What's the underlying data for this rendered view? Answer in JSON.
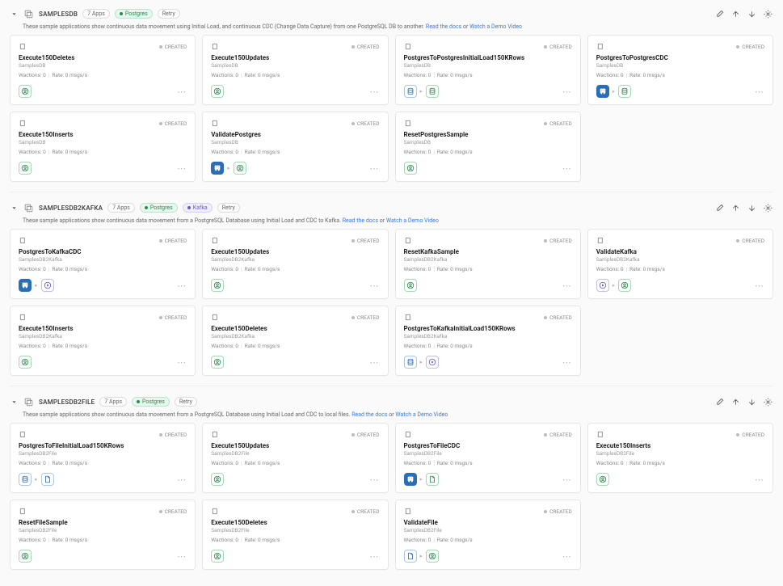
{
  "groups": [
    {
      "name": "SAMPLESDB",
      "count": "7 Apps",
      "tags": [
        {
          "kind": "post",
          "label": "Postgres"
        },
        {
          "kind": "retry",
          "label": "Retry"
        }
      ],
      "desc_plain": "These sample applications show continuous data movement using Initial Load, and continuous CDC (Change Data Capture) from one PostgreSQL DB to another. ",
      "link1": "Read the docs",
      "link_sep": " or ",
      "link2": "Watch a Demo Video",
      "cards": [
        {
          "title": "Execute150Deletes",
          "sub": "SamplesDB",
          "wact": "Wactions: 0",
          "rate": "Rate: 0 msgs/s",
          "status": "CREATED",
          "icons": [
            {
              "c": "green",
              "g": "circuser"
            }
          ]
        },
        {
          "title": "Execute150Updates",
          "sub": "SamplesDB",
          "wact": "Wactions: 0",
          "rate": "Rate: 0 msgs/s",
          "status": "CREATED",
          "icons": [
            {
              "c": "green",
              "g": "circuser"
            }
          ]
        },
        {
          "title": "PostgresToPostgresInitialLoad150KRows",
          "sub": "SamplesDB",
          "wact": "Wactions: 0",
          "rate": "Rate: 0 msgs/s",
          "status": "CREATED",
          "icons": [
            {
              "c": "blue",
              "g": "db"
            },
            {
              "arrow": true
            },
            {
              "c": "green",
              "g": "db"
            }
          ]
        },
        {
          "title": "PostgresToPostgresCDC",
          "sub": "SamplesDB",
          "wact": "Wactions: 0",
          "rate": "Rate: 0 msgs/s",
          "status": "CREATED",
          "icons": [
            {
              "c": "bluefill",
              "g": "elephant"
            },
            {
              "arrow": true
            },
            {
              "c": "green",
              "g": "db"
            }
          ]
        },
        {
          "title": "Execute150Inserts",
          "sub": "SamplesDB",
          "wact": "Wactions: 0",
          "rate": "Rate: 0 msgs/s",
          "status": "CREATED",
          "icons": [
            {
              "c": "green",
              "g": "circuser"
            }
          ]
        },
        {
          "title": "ValidatePostgres",
          "sub": "SamplesDB",
          "wact": "Wactions: 0",
          "rate": "Rate: 0 msgs/s",
          "status": "CREATED",
          "icons": [
            {
              "c": "bluefill",
              "g": "elephant"
            },
            {
              "arrow": true
            },
            {
              "c": "green",
              "g": "circuser"
            }
          ]
        },
        {
          "title": "ResetPostgresSample",
          "sub": "SamplesDB",
          "wact": "Wactions: 0",
          "rate": "Rate: 0 msgs/s",
          "status": "CREATED",
          "icons": [
            {
              "c": "green",
              "g": "circuser"
            }
          ]
        }
      ]
    },
    {
      "name": "SAMPLESDB2KAFKA",
      "count": "7 Apps",
      "tags": [
        {
          "kind": "post",
          "label": "Postgres"
        },
        {
          "kind": "kaf",
          "label": "Kafka"
        },
        {
          "kind": "retry",
          "label": "Retry"
        }
      ],
      "desc_plain": "These sample applications show continuous data movement from a PostgreSQL Database using Initial Load and CDC to Kafka. ",
      "link1": "Read the docs",
      "link_sep": " or ",
      "link2": "Watch a Demo Video",
      "cards": [
        {
          "title": "PostgresToKafkaCDC",
          "sub": "SamplesDB2Kafka",
          "wact": "Wactions: 0",
          "rate": "Rate: 0 msgs/s",
          "status": "CREATED",
          "icons": [
            {
              "c": "bluefill",
              "g": "elephant"
            },
            {
              "arrow": true
            },
            {
              "c": "purple",
              "g": "play"
            }
          ]
        },
        {
          "title": "Execute150Updates",
          "sub": "SamplesDB2Kafka",
          "wact": "Wactions: 0",
          "rate": "Rate: 0 msgs/s",
          "status": "CREATED",
          "icons": [
            {
              "c": "green",
              "g": "circuser"
            }
          ]
        },
        {
          "title": "ResetKafkaSample",
          "sub": "SamplesDB2Kafka",
          "wact": "Wactions: 0",
          "rate": "Rate: 0 msgs/s",
          "status": "CREATED",
          "icons": [
            {
              "c": "green",
              "g": "circuser"
            }
          ]
        },
        {
          "title": "ValidateKafka",
          "sub": "SamplesDB2Kafka",
          "wact": "Wactions: 0",
          "rate": "Rate: 0 msgs/s",
          "status": "CREATED",
          "icons": [
            {
              "c": "purple",
              "g": "play"
            },
            {
              "arrow": true
            },
            {
              "c": "green",
              "g": "circuser"
            }
          ]
        },
        {
          "title": "Execute150Inserts",
          "sub": "SamplesDB2Kafka",
          "wact": "Wactions: 0",
          "rate": "Rate: 0 msgs/s",
          "status": "CREATED",
          "icons": [
            {
              "c": "green",
              "g": "circuser"
            }
          ]
        },
        {
          "title": "Execute150Deletes",
          "sub": "SamplesDB2Kafka",
          "wact": "Wactions: 0",
          "rate": "Rate: 0 msgs/s",
          "status": "CREATED",
          "icons": [
            {
              "c": "green",
              "g": "circuser"
            }
          ]
        },
        {
          "title": "PostgresToKafkaInitialLoad150KRows",
          "sub": "SamplesDB2Kafka",
          "wact": "Wactions: 0",
          "rate": "Rate: 0 msgs/s",
          "status": "CREATED",
          "icons": [
            {
              "c": "blue",
              "g": "db"
            },
            {
              "arrow": true
            },
            {
              "c": "purple",
              "g": "play"
            }
          ]
        }
      ]
    },
    {
      "name": "SAMPLESDB2FILE",
      "count": "7 Apps",
      "tags": [
        {
          "kind": "post",
          "label": "Postgres"
        },
        {
          "kind": "retry",
          "label": "Retry"
        }
      ],
      "desc_plain": "These sample applications show continuous data movement from a PostgreSQL Database using Initial Load and CDC to local files. ",
      "link1": "Read the docs",
      "link_sep": " or ",
      "link2": "Watch a Demo Video",
      "cards": [
        {
          "title": "PostgresToFileInitialLoad150KRows",
          "sub": "SamplesDB2File",
          "wact": "Wactions: 0",
          "rate": "Rate: 0 msgs/s",
          "status": "CREATED",
          "icons": [
            {
              "c": "blue",
              "g": "db"
            },
            {
              "arrow": true
            },
            {
              "c": "blue",
              "g": "file"
            }
          ]
        },
        {
          "title": "Execute150Updates",
          "sub": "SamplesDB2File",
          "wact": "Wactions: 0",
          "rate": "Rate: 0 msgs/s",
          "status": "CREATED",
          "icons": [
            {
              "c": "green",
              "g": "circuser"
            }
          ]
        },
        {
          "title": "PostgresToFileCDC",
          "sub": "SamplesDB2File",
          "wact": "Wactions: 0",
          "rate": "Rate: 0 msgs/s",
          "status": "CREATED",
          "icons": [
            {
              "c": "bluefill",
              "g": "elephant"
            },
            {
              "arrow": true
            },
            {
              "c": "green",
              "g": "file"
            }
          ]
        },
        {
          "title": "Execute150Inserts",
          "sub": "SamplesDB2File",
          "wact": "Wactions: 0",
          "rate": "Rate: 0 msgs/s",
          "status": "CREATED",
          "icons": [
            {
              "c": "green",
              "g": "circuser"
            }
          ]
        },
        {
          "title": "ResetFileSample",
          "sub": "SamplesDB2File",
          "wact": "Wactions: 0",
          "rate": "Rate: 0 msgs/s",
          "status": "CREATED",
          "icons": [
            {
              "c": "green",
              "g": "circuser"
            }
          ]
        },
        {
          "title": "Execute150Deletes",
          "sub": "SamplesDB2File",
          "wact": "Wactions: 0",
          "rate": "Rate: 0 msgs/s",
          "status": "CREATED",
          "icons": [
            {
              "c": "green",
              "g": "circuser"
            }
          ]
        },
        {
          "title": "ValidateFile",
          "sub": "SamplesDB2File",
          "wact": "Wactions: 0",
          "rate": "Rate: 0 msgs/s",
          "status": "CREATED",
          "icons": [
            {
              "c": "blue",
              "g": "file"
            },
            {
              "arrow": true
            },
            {
              "c": "green",
              "g": "circuser"
            }
          ]
        }
      ]
    }
  ]
}
